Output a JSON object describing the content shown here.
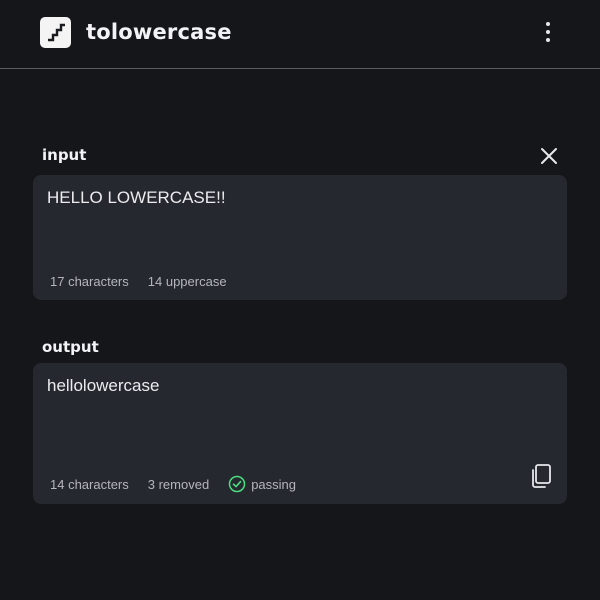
{
  "app": {
    "title": "tolowercase",
    "logo_icon": "stairs-icon",
    "menu_icon": "kebab-menu-icon"
  },
  "input": {
    "label": "input",
    "text": "HELLO LOWERCASE!!",
    "clear_icon": "close-icon",
    "stats": {
      "characters": "17 characters",
      "uppercase": "14 uppercase"
    }
  },
  "output": {
    "label": "output",
    "text": "hellolowercase",
    "copy_icon": "copy-icon",
    "stats": {
      "characters": "14 characters",
      "removed": "3 removed",
      "status": "passing",
      "status_icon": "check-circle-icon",
      "status_color": "#4ade80"
    }
  },
  "colors": {
    "background": "#151619",
    "panel": "#262830",
    "divider": "#5a5c62"
  }
}
